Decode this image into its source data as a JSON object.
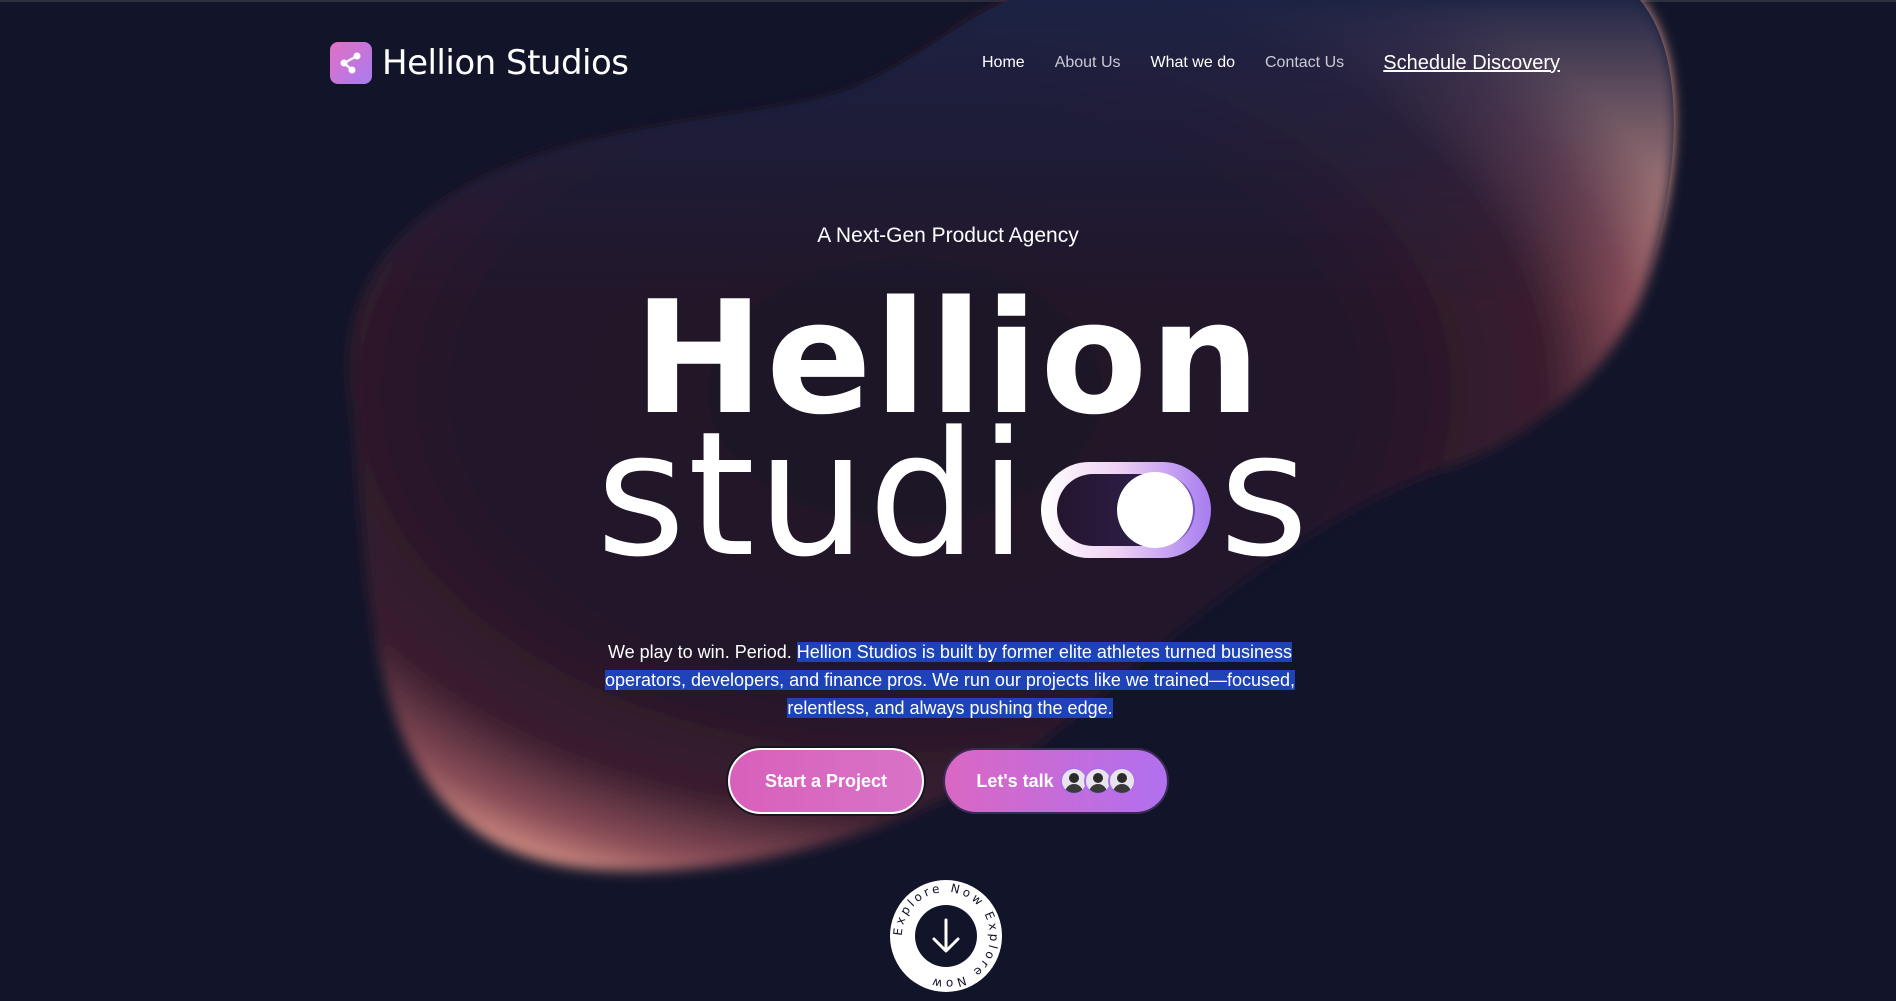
{
  "nav": {
    "brand_name": "Hellion Studios",
    "items": [
      {
        "label": "Home"
      },
      {
        "label": "About Us"
      },
      {
        "label": "What we do"
      },
      {
        "label": "Contact Us"
      }
    ],
    "cta_label": "Schedule Discovery"
  },
  "hero": {
    "eyebrow": "A Next-Gen Product Agency",
    "title_line1": "Hellion",
    "title_line2_start": "studi",
    "title_line2_end": "s",
    "description_plain": "We play to win. Period.",
    "description_selected": "Hellion Studios is built by former elite athletes turned business operators, developers, and finance pros. We run our projects like we trained—focused, relentless, and always pushing the edge."
  },
  "buttons": {
    "start_label": "Start a Project",
    "talk_label": "Let's talk"
  },
  "explore": {
    "ring_text": "Explore Now Explore Now "
  },
  "colors": {
    "background": "#12152a",
    "accent_pink": "#d860ba",
    "accent_purple": "#a77cf0",
    "selection": "#1e43b6"
  },
  "icons": {
    "logo": "nodes-logo-icon",
    "explore": "arrow-down-icon"
  }
}
